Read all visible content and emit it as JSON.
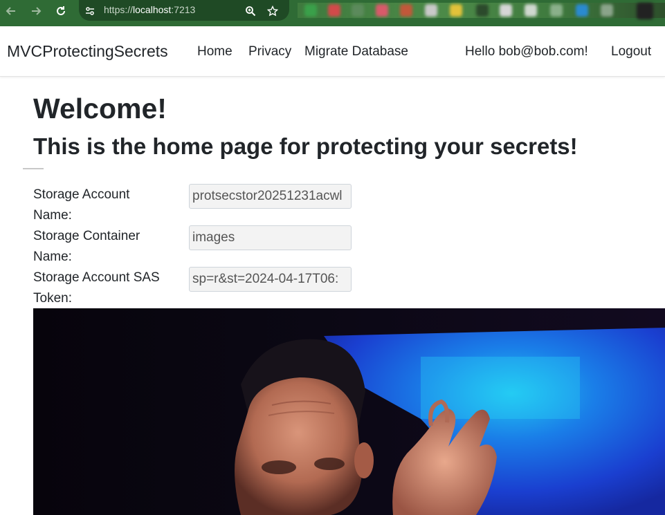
{
  "browser": {
    "url_prefix": "https://",
    "url_host": "localhost",
    "url_port": ":7213",
    "icons": {
      "back": "arrow-left-icon",
      "forward": "arrow-right-icon",
      "reload": "reload-icon",
      "site_info": "site-settings-icon",
      "zoom": "zoom-icon",
      "bookmark": "star-icon"
    }
  },
  "navbar": {
    "brand": "MVCProtectingSecrets",
    "links": [
      "Home",
      "Privacy",
      "Migrate Database"
    ],
    "greeting": "Hello bob@bob.com!",
    "logout": "Logout"
  },
  "main": {
    "title": "Welcome!",
    "subtitle": "This is the home page for protecting your secrets!",
    "fields": [
      {
        "label": "Storage Account Name:",
        "value": "protsecstor20251231acwl"
      },
      {
        "label": "Storage Container Name:",
        "value": "images"
      },
      {
        "label": "Storage Account SAS Token:",
        "value": "sp=r&st=2024-04-17T06:"
      }
    ]
  },
  "colors": {
    "browser_bar": "#2f6b35",
    "text": "#212529",
    "input_bg": "#f3f3f3"
  }
}
